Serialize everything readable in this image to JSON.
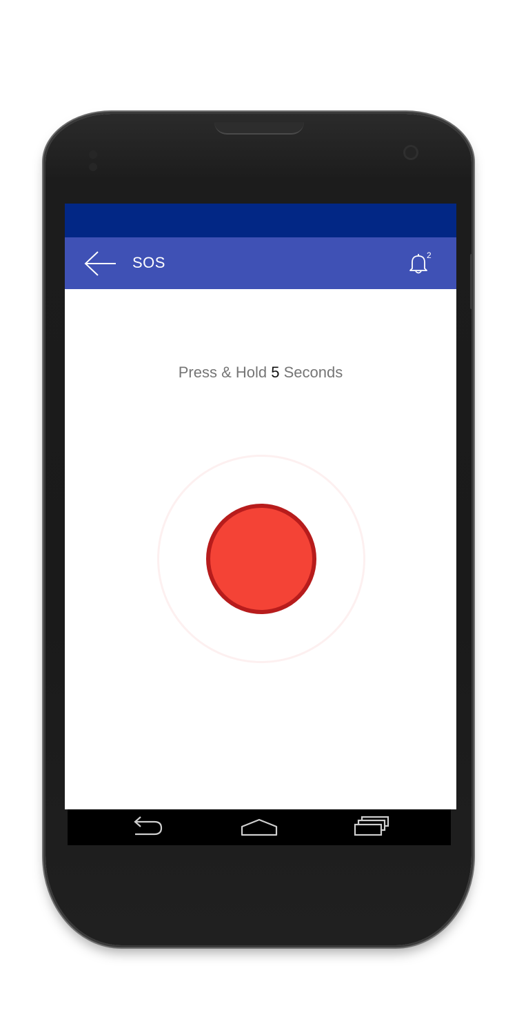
{
  "app_bar": {
    "title": "SOS",
    "notification_count": "2",
    "back_icon": "arrow-left-icon",
    "bell_icon": "bell-icon"
  },
  "instruction": {
    "prefix": "Press & Hold ",
    "seconds": "5",
    "suffix": " Seconds"
  },
  "sos_button": {
    "icon": "red-circle-button"
  },
  "nav_bar": {
    "back_icon": "nav-back-icon",
    "home_icon": "nav-home-icon",
    "recents_icon": "nav-recents-icon"
  },
  "colors": {
    "status_bar": "#022785",
    "app_bar": "#3f51b5",
    "sos_fill": "#f44336",
    "sos_border": "#b71c1c"
  }
}
